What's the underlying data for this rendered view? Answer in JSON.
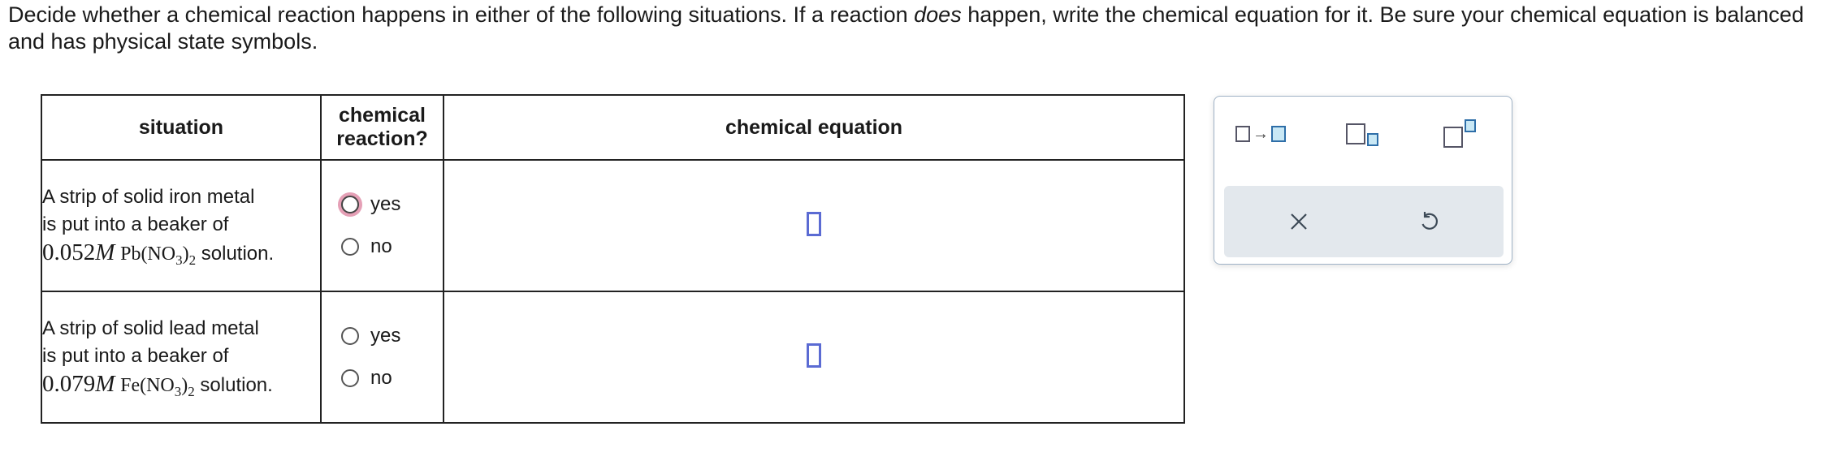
{
  "instructions": {
    "part1": "Decide whether a chemical reaction happens in either of the following situations. If a reaction ",
    "emphasis": "does",
    "part2": " happen, write the chemical equation for it. Be sure your chemical equation is balanced and has physical state symbols."
  },
  "table": {
    "headers": {
      "situation": "situation",
      "reaction_line1": "chemical",
      "reaction_line2": "reaction?",
      "equation": "chemical equation"
    },
    "rows": [
      {
        "line1": "A strip of solid iron metal",
        "line2": "is put into a beaker of",
        "concentration": "0.052",
        "molarity_unit": "M",
        "formula_prefix": "Pb(NO",
        "formula_sub1": "3",
        "formula_mid": ")",
        "formula_sub2": "2",
        "suffix": " solution.",
        "option_yes": "yes",
        "option_no": "no"
      },
      {
        "line1": "A strip of solid lead metal",
        "line2": "is put into a beaker of",
        "concentration": "0.079",
        "molarity_unit": "M",
        "formula_prefix": "Fe(NO",
        "formula_sub1": "3",
        "formula_mid": ")",
        "formula_sub2": "2",
        "suffix": " solution.",
        "option_yes": "yes",
        "option_no": "no"
      }
    ]
  },
  "palette": {
    "tools": [
      "reaction-arrow-icon",
      "subscript-icon",
      "superscript-icon"
    ],
    "actions": [
      "clear-icon",
      "undo-icon"
    ],
    "arrow_glyph": "→"
  },
  "colors": {
    "answer_box": "#5b6bd3",
    "focus_ring": "#e5a0b6",
    "palette_tool_fill": "#c9e8f5",
    "action_bar": "#e3e8ed"
  }
}
